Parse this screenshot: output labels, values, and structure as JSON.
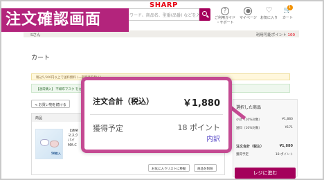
{
  "header": {
    "logo": "SHARP",
    "search_placeholder": "キーワード、商品名、型番(品番) などを入力",
    "nav": {
      "guide": "ご利用ガイド",
      "support": "・サポート",
      "mypage": "マイページ",
      "favorites": "お気に入り",
      "cart": "カート",
      "cart_count": "1"
    }
  },
  "userbar": {
    "name": "Sさん",
    "points_label": "利用可能ポイント",
    "points_value": "100"
  },
  "page": {
    "title": "カート",
    "notice_yellow": "税込5,500円以上で送料無料 (一部商品を除く)",
    "notice_green": "【通常購入】 不織布マスク をカートに追加しました",
    "back_button": "< お買い物を続ける"
  },
  "item": {
    "header": "商品",
    "lines": [
      "【通常",
      "マスク",
      "パイ",
      "MA-C"
    ],
    "tag": "50枚入",
    "wishlist_button": "お気に入りリストに移動",
    "delete_button": "商品を削除"
  },
  "side": {
    "title": "選択した商品",
    "rows": [
      {
        "label": "小計（10%対象）",
        "value": "¥1,880"
      },
      {
        "label": "送料（10%対象）",
        "value": "¥171"
      }
    ],
    "total_label": "注文合計（税込）",
    "total_value": "¥1,880",
    "earn_label": "獲得予定",
    "earn_value": "18 ポイント",
    "checkout": "レジに進む"
  },
  "banner": {
    "text": "注文確認画面"
  },
  "callout": {
    "total_label": "注文合計（税込）",
    "total_value": "￥1,880",
    "earn_label": "獲得予定",
    "earn_points": "18 ポイント",
    "breakdown_link": "内訳"
  },
  "colors": {
    "brand_red": "#e60012",
    "accent_magenta": "#a4005b",
    "banner": "#b3247c",
    "callout_border": "#c44a92"
  }
}
